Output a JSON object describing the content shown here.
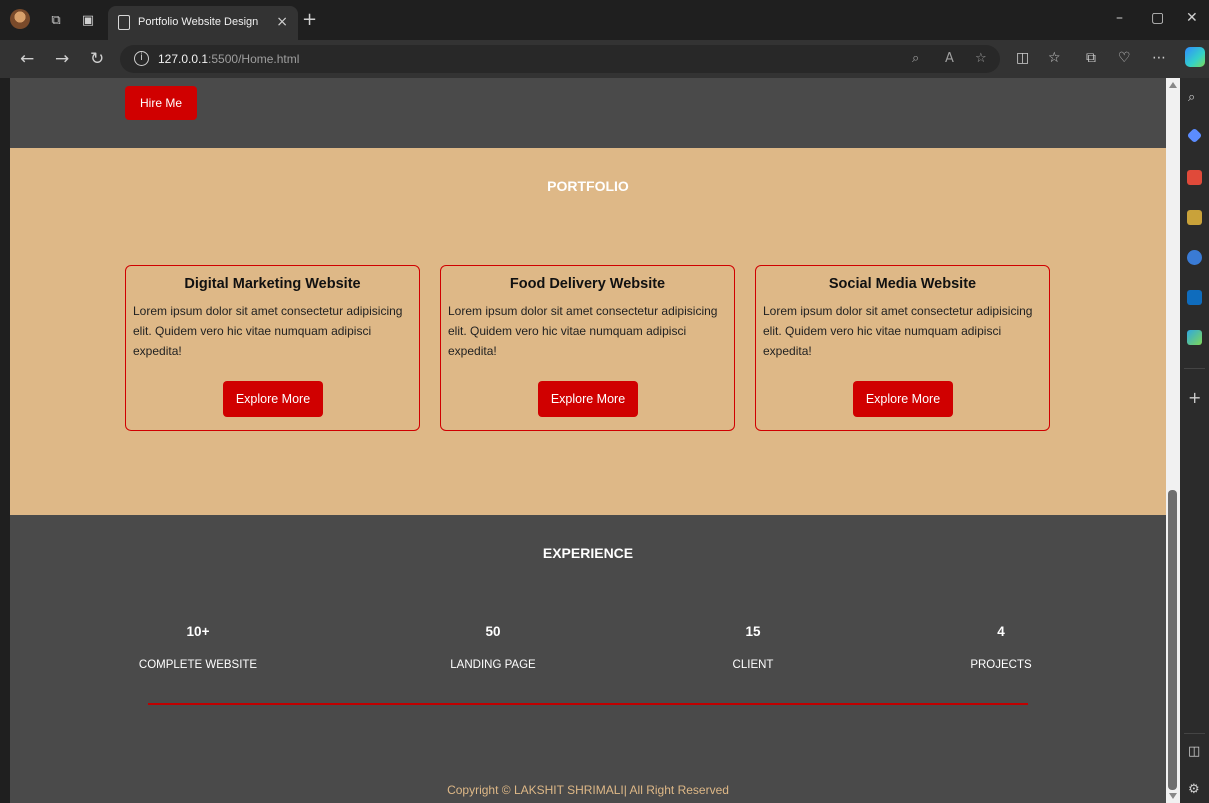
{
  "browser": {
    "tab_title": "Portfolio Website Design",
    "tab_close": "×",
    "new_tab": "+",
    "url_host": "127.0.0.1",
    "url_rest": ":5500/Home.html",
    "window_controls": [
      "–",
      "▢",
      "✕"
    ]
  },
  "page": {
    "hire_button": "Hire Me",
    "portfolio": {
      "title": "PORTFOLIO",
      "cards": [
        {
          "title": "Digital Marketing Website",
          "text": "Lorem ipsum dolor sit amet consectetur adipisicing elit. Quidem vero hic vitae numquam adipisci expedita!",
          "button": "Explore More"
        },
        {
          "title": "Food Delivery Website",
          "text": "Lorem ipsum dolor sit amet consectetur adipisicing elit. Quidem vero hic vitae numquam adipisci expedita!",
          "button": "Explore More"
        },
        {
          "title": "Social Media Website",
          "text": "Lorem ipsum dolor sit amet consectetur adipisicing elit. Quidem vero hic vitae numquam adipisci expedita!",
          "button": "Explore More"
        }
      ]
    },
    "experience": {
      "title": "EXPERIENCE",
      "stats": [
        {
          "value": "10+",
          "label": "COMPLETE WEBSITE"
        },
        {
          "value": "50",
          "label": "LANDING PAGE"
        },
        {
          "value": "15",
          "label": "CLIENT"
        },
        {
          "value": "4",
          "label": "PROJECTS"
        }
      ]
    },
    "copyright": "Copyright © LAKSHIT SHRIMALI| All Right Reserved"
  },
  "colors": {
    "accent_red": "#d00000",
    "portfolio_bg": "#deb887",
    "dark_bg": "#4a4a4a"
  }
}
